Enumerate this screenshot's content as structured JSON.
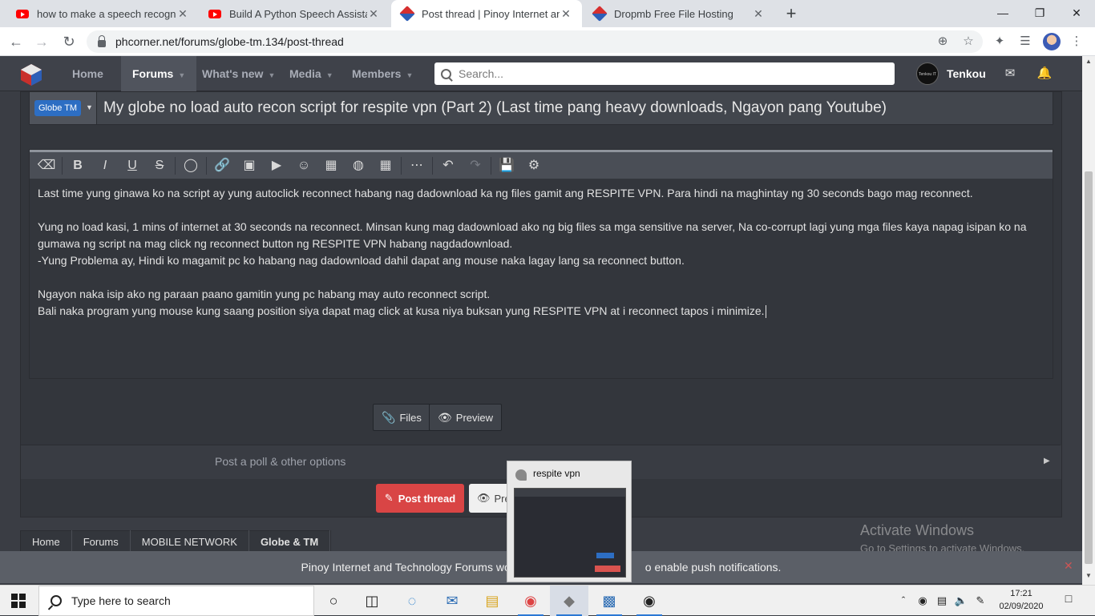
{
  "browser": {
    "tabs": [
      {
        "title": "how to make a speech recognitic",
        "icon": "youtube-icon"
      },
      {
        "title": "Build A Python Speech Assistant",
        "icon": "youtube-icon"
      },
      {
        "title": "Post thread | Pinoy Internet and T",
        "icon": "phcorner-icon"
      },
      {
        "title": "Dropmb Free File Hosting",
        "icon": "dropmb-icon"
      }
    ],
    "url": "phcorner.net/forums/globe-tm.134/post-thread"
  },
  "site": {
    "nav": {
      "home": "Home",
      "forums": "Forums",
      "whats_new": "What's new",
      "media": "Media",
      "members": "Members"
    },
    "search_placeholder": "Search...",
    "username": "Tenkou",
    "avatar_text": "Tenkou IT"
  },
  "thread": {
    "prefix": "Globe TM",
    "title": "My globe no load auto recon script for respite vpn (Part 2) (Last time pang heavy downloads, Ngayon pang Youtube)"
  },
  "editor": {
    "lines": [
      "Last time yung ginawa ko na script ay yung autoclick reconnect habang nag dadownload ka ng files gamit ang RESPITE VPN. Para hindi na maghintay ng 30 seconds bago mag reconnect.",
      "",
      "Yung no load kasi, 1 mins of internet at 30 seconds na reconnect. Minsan kung mag dadownload ako ng big files sa mga sensitive na server, Na co-corrupt lagi yung mga files kaya napag isipan ko na",
      "gumawa ng script na mag click ng reconnect button ng RESPITE VPN habang nagdadownload.",
      "-Yung Problema ay, Hindi ko magamit pc ko habang nag dadownload dahil dapat ang mouse naka lagay lang sa reconnect button.",
      "",
      "Ngayon naka isip ako ng paraan paano gamitin yung pc habang may auto reconnect script.",
      "Bali naka program yung mouse kung saang position siya dapat mag click at kusa niya buksan yung RESPITE VPN at i reconnect tapos i minimize."
    ]
  },
  "buttons": {
    "files": "Files",
    "preview": "Preview",
    "post_thread": "Post thread",
    "preview_partial": "Pre"
  },
  "poll_options": "Post a poll & other options",
  "breadcrumb": [
    "Home",
    "Forums",
    "MOBILE NETWORK",
    "Globe & TM"
  ],
  "activation": {
    "line1": "Activate Windows",
    "line2": "Go to Settings to activate Windows."
  },
  "notice": {
    "left": "Pinoy Internet and Technology Forums wo",
    "right": "o enable push notifications."
  },
  "popup": {
    "title": "respite vpn"
  },
  "taskbar": {
    "search_placeholder": "Type here to search",
    "time": "17:21",
    "date": "02/09/2020"
  },
  "colors": {
    "accent_red": "#d94545",
    "prefix_blue": "#2d6ec3",
    "nav_bg": "#3f424a"
  }
}
